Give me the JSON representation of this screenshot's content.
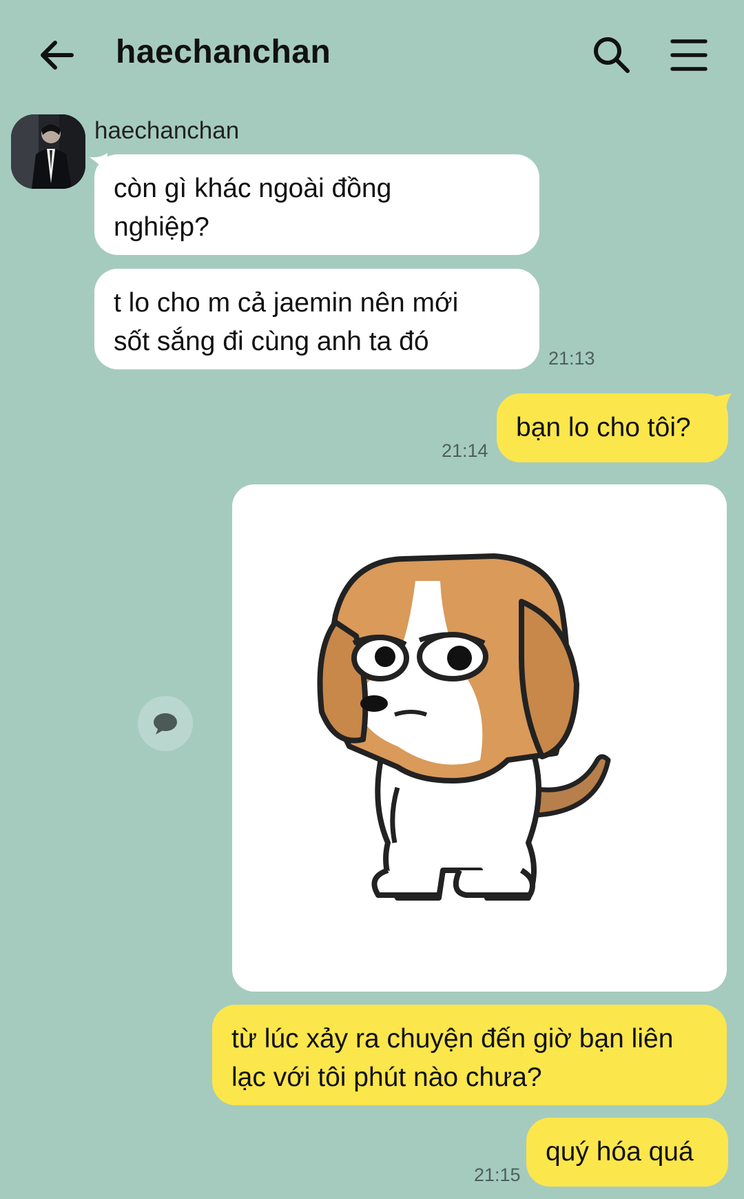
{
  "header": {
    "title": "haechanchan"
  },
  "icons": {
    "back": "arrow-left-icon",
    "search": "search-icon",
    "menu": "hamburger-menu-icon",
    "reply": "speech-bubble-icon"
  },
  "colors": {
    "background": "#a5cbbf",
    "incoming_bubble": "#ffffff",
    "outgoing_bubble": "#fbe64c"
  },
  "messages": {
    "sender_name": "haechanchan",
    "m1": "còn gì khác ngoài đồng\nnghiệp?",
    "m2": "t lo cho m cả jaemin nên mới\nsốt sắng đi cùng anh ta đó",
    "m2_time": "21:13",
    "m3": "bạn lo cho tôi?",
    "m3_time": "21:14",
    "m4": "từ lúc xảy ra chuyện đến giờ bạn liên\nlạc với tôi phút nào chưa?",
    "m5": "quý hóa quá",
    "m5_time": "21:15"
  }
}
